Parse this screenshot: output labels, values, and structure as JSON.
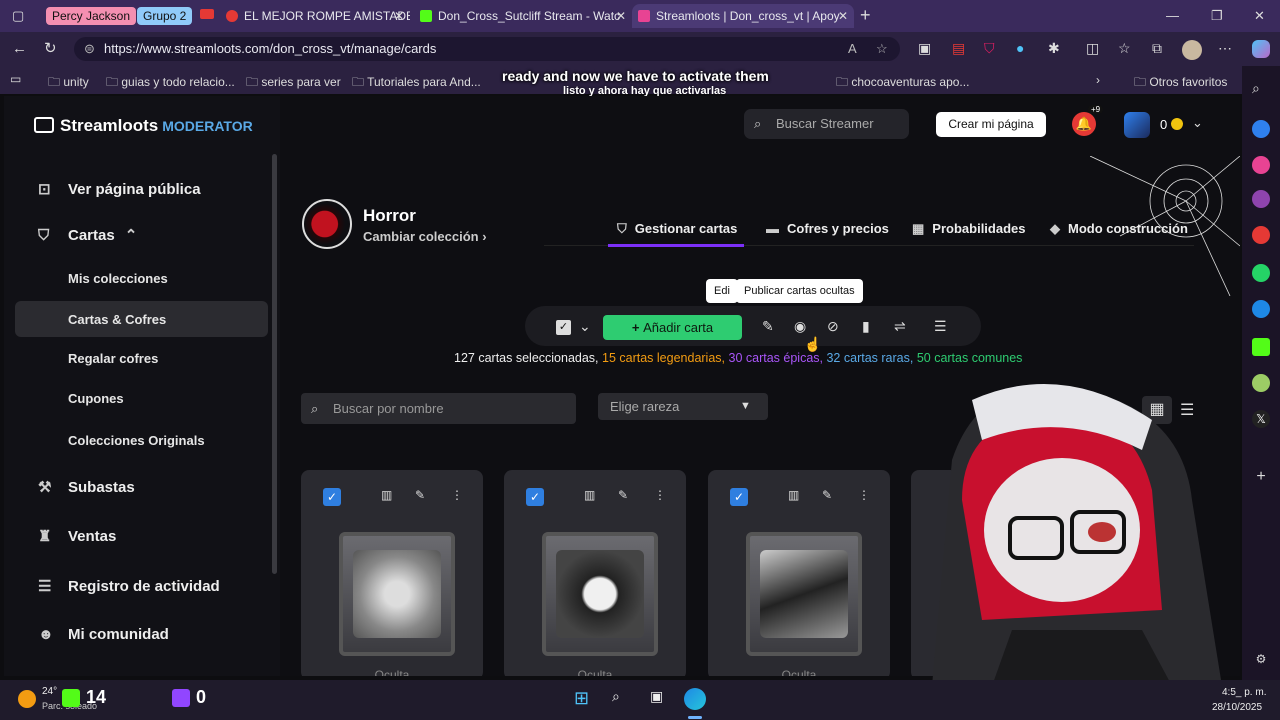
{
  "browser": {
    "groups": [
      {
        "label": "Percy Jackson",
        "color": "#f48fb1"
      },
      {
        "label": "Grupo 2",
        "color": "#90caf9"
      }
    ],
    "tabs": [
      {
        "title": "EL MEJOR ROMPE AMISTADE",
        "favicon_color": "#e53935",
        "active": false
      },
      {
        "title": "Don_Cross_Sutcliff Stream - Watc",
        "favicon_color": "#53fc18",
        "active": false
      },
      {
        "title": "Streamloots | Don_cross_vt | Apoy",
        "favicon_color": "#e84393",
        "active": true
      }
    ],
    "url": "https://www.streamloots.com/don_cross_vt/manage/cards",
    "bookmarks": [
      "unity",
      "guias y todo relacio...",
      "series para ver",
      "Tutoriales para And...",
      "chocoaventuras apo...",
      "Otros favoritos"
    ],
    "subtitle_en": "ready and now we have to activate them",
    "subtitle_es": "listo y ahora hay que activarlas"
  },
  "app": {
    "brand": "Streamloots",
    "brand_tag": "MODERATOR",
    "search_placeholder": "Buscar Streamer",
    "create_page": "Crear mi página",
    "notif_badge": "+9",
    "coins": "0",
    "sidebar": {
      "ver_pagina": "Ver página pública",
      "cartas": "Cartas",
      "sub_items": [
        "Mis colecciones",
        "Cartas & Cofres",
        "Regalar cofres",
        "Cupones",
        "Colecciones Originals"
      ],
      "subastas": "Subastas",
      "ventas": "Ventas",
      "registro": "Registro de actividad",
      "comunidad": "Mi comunidad"
    },
    "collection": {
      "name": "Horror",
      "change": "Cambiar colección"
    },
    "tabs": [
      "Gestionar cartas",
      "Cofres y precios",
      "Probabilidades",
      "Modo construcción"
    ],
    "toolbar": {
      "add_card": "Añadir carta",
      "tooltip_partial": "Edi",
      "tooltip": "Publicar cartas ocultas"
    },
    "counts": {
      "selected": "127 cartas seleccionadas,",
      "legendary": "15 cartas legendarias,",
      "epic": "30 cartas épicas,",
      "rare": "32 cartas raras,",
      "common": "50 cartas comunes"
    },
    "rarity_colors": {
      "legendary": "#f39c12",
      "epic": "#a855f7",
      "rare": "#5aa9e6",
      "common": "#2ecc71"
    },
    "filters": {
      "name_placeholder": "Buscar por nombre",
      "rarity_placeholder": "Elige rareza"
    },
    "cards": [
      {
        "label": "Oculta"
      },
      {
        "label": "Oculta"
      },
      {
        "label": "Oculta"
      }
    ]
  },
  "taskbar": {
    "temp": "24°",
    "weather": "Parc. soleado",
    "kick_count": "14",
    "twitch_count": "0",
    "time": "4:5_ p. m.",
    "date": "28/10/2025"
  }
}
